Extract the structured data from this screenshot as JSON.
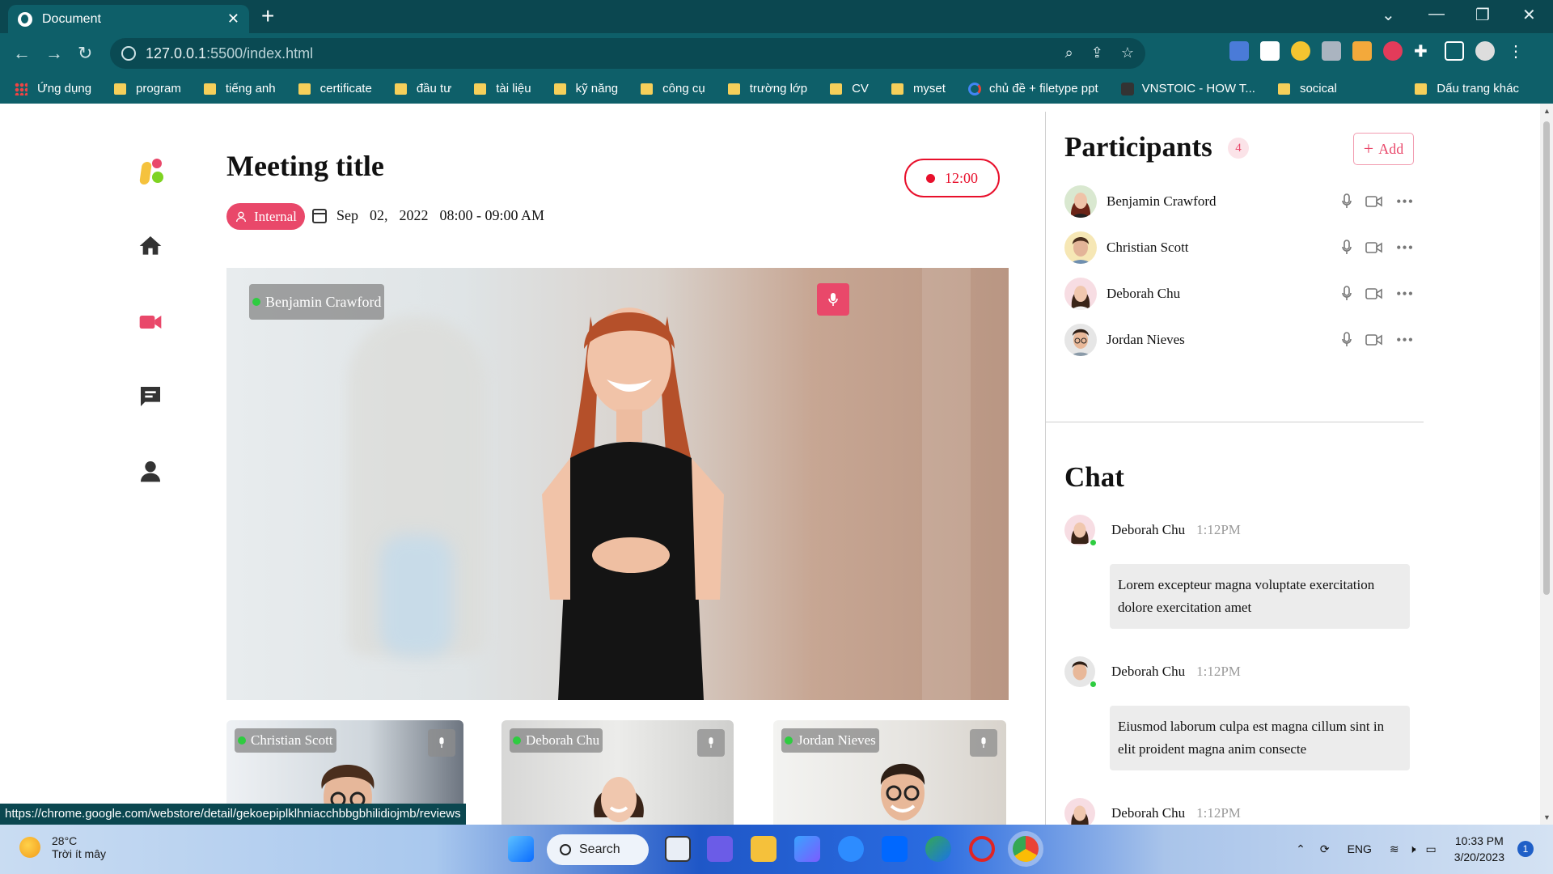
{
  "browser": {
    "tab_title": "Document",
    "tab_close": "✕",
    "new_tab": "+",
    "url_host": "127.0.0.1",
    "url_rest": ":5500/index.html",
    "bookmarks": [
      "Ứng dụng",
      "program",
      "tiếng anh",
      "certificate",
      "đầu tư",
      "tài liệu",
      "kỹ năng",
      "công cụ",
      "trường lớp",
      "CV",
      "myset",
      "chủ đề + filetype ppt",
      "VNSTOIC - HOW T...",
      "socical"
    ],
    "bookmarks_other": "Dấu trang khác",
    "status_url": "https://chrome.google.com/webstore/detail/gekoepiplklhniacchbbgbhilidiojmb/reviews"
  },
  "meeting": {
    "title": "Meeting title",
    "tag": "Internal",
    "date_month": "Sep",
    "date_day": "02,",
    "date_year": "2022",
    "time_range": "08:00 - 09:00 AM",
    "timer": "12:00",
    "main_speaker": "Benjamin Crawford",
    "thumbnails": [
      {
        "name": "Christian Scott"
      },
      {
        "name": "Deborah Chu"
      },
      {
        "name": "Jordan Nieves"
      }
    ]
  },
  "participants": {
    "title": "Participants",
    "count": "4",
    "add_label": "Add",
    "list": [
      {
        "name": "Benjamin Crawford"
      },
      {
        "name": "Christian Scott"
      },
      {
        "name": "Deborah Chu"
      },
      {
        "name": "Jordan Nieves"
      }
    ]
  },
  "chat": {
    "title": "Chat",
    "messages": [
      {
        "name": "Deborah Chu",
        "time": "1:12PM",
        "text": "Lorem excepteur magna voluptate exercitation dolore exercitation amet"
      },
      {
        "name": "Deborah Chu",
        "time": "1:12PM",
        "text": "Eiusmod laborum culpa est magna cillum sint in elit proident magna anim consecte"
      },
      {
        "name": "Deborah Chu",
        "time": "1:12PM",
        "text": ""
      }
    ]
  },
  "taskbar": {
    "temp": "28°C",
    "weather": "Trời ít mây",
    "search": "Search",
    "lang": "ENG",
    "time": "10:33 PM",
    "date": "3/20/2023",
    "notifications": "1"
  },
  "colors": {
    "accent": "#e9486a",
    "record": "#e8102c",
    "chrome": "#0e5f69"
  }
}
